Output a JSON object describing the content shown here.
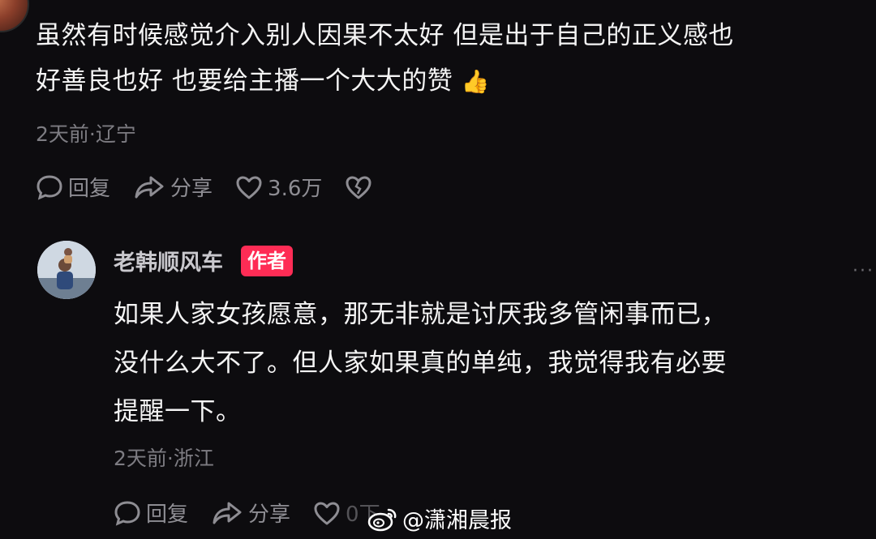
{
  "comment1": {
    "text_line1": "虽然有时候感觉介入别人因果不太好 但是出于自己的正义感也",
    "text_line2": "好善良也好 也要给主播一个大大的赞",
    "emoji": "👍",
    "meta": "2天前·辽宁",
    "reply_label": "回复",
    "share_label": "分享",
    "like_count": "3.6万"
  },
  "reply": {
    "author": "老韩顺风车",
    "badge": "作者",
    "more": "···",
    "text_line1": "如果人家女孩愿意，那无非就是讨厌我多管闲事而已，",
    "text_line2": "没什么大不了。但人家如果真的单纯，我觉得我有必要",
    "text_line3": "提醒一下。",
    "meta": "2天前·浙江",
    "reply_label": "回复",
    "share_label": "分享",
    "like_count": "0下"
  },
  "watermark": {
    "text": "@潇湘晨报"
  },
  "colors": {
    "background": "#0d0c0f",
    "badge": "#fe2c55",
    "muted": "#8e8d93"
  }
}
